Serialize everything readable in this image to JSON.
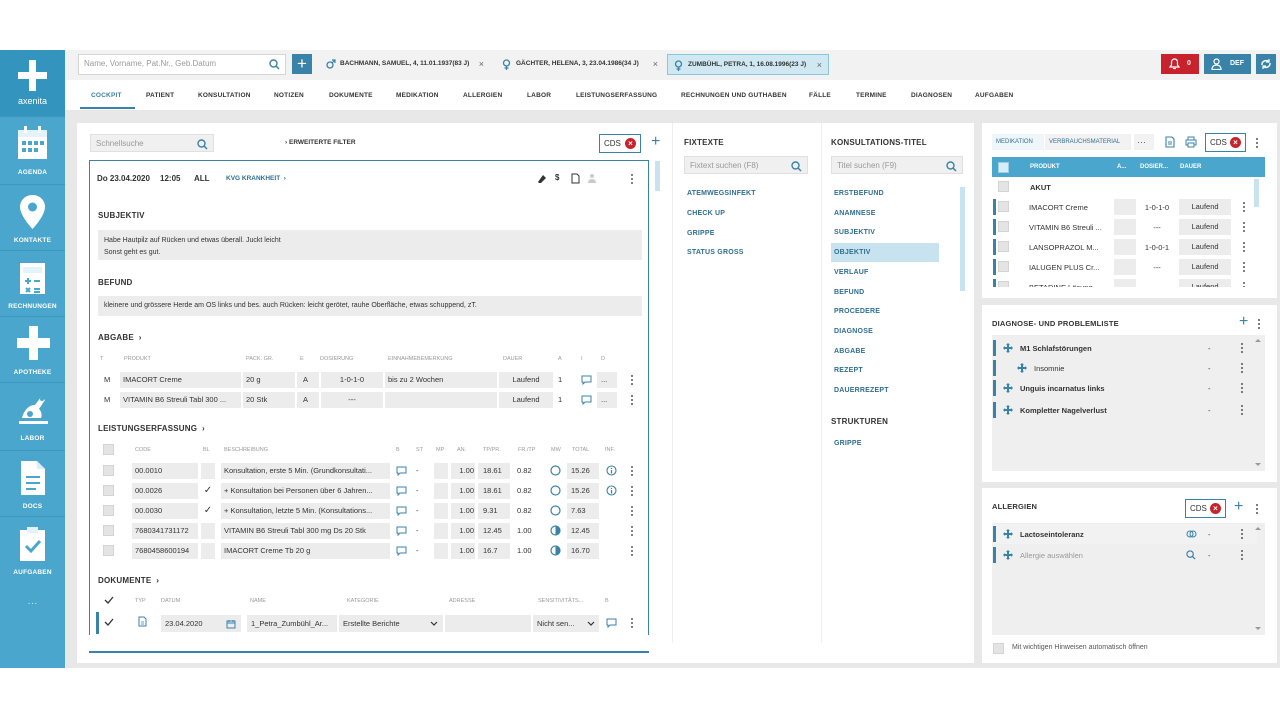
{
  "sidebar": {
    "brand": "axenita",
    "items": [
      {
        "label": "AGENDA",
        "icon": "calendar-icon"
      },
      {
        "label": "KONTAKTE",
        "icon": "location-pin-icon"
      },
      {
        "label": "RECHNUNGEN",
        "icon": "calculator-icon"
      },
      {
        "label": "APOTHEKE",
        "icon": "pharmacy-cross-icon"
      },
      {
        "label": "LABOR",
        "icon": "lab-flask-icon"
      },
      {
        "label": "DOCS",
        "icon": "document-icon"
      },
      {
        "label": "AUFGABEN",
        "icon": "clipboard-check-icon"
      }
    ],
    "more": "···"
  },
  "topbar": {
    "search_placeholder": "Name, Vorname, Pat.Nr., Geb.Datum",
    "add": "+",
    "patients": [
      {
        "label": "BACHMANN, SAMUEL, 4, 11.01.1937(83 J)",
        "icon": "male-icon"
      },
      {
        "label": "GÄCHTER, HELENA, 3, 23.04.1986(34 J)",
        "icon": "female-icon"
      },
      {
        "label": "ZUMBÜHL, PETRA, 1, 16.08.1996(23 J)",
        "icon": "female-icon"
      }
    ],
    "close": "×",
    "notif_count": "0",
    "user": "DEF",
    "colors": {
      "red": "#c8232c",
      "blue": "#3a83a8"
    }
  },
  "tabs": [
    "COCKPIT",
    "PATIENT",
    "KONSULTATION",
    "NOTIZEN",
    "DOKUMENTE",
    "MEDIKATION",
    "ALLERGIEN",
    "LABOR",
    "LEISTUNGSERFASSUNG",
    "RECHNUNGEN UND GUTHABEN",
    "FÄLLE",
    "TERMINE",
    "DIAGNOSEN",
    "AUFGABEN"
  ],
  "consult": {
    "quick_search": "Schnellsuche",
    "ext_filter": "ERWEITERTE FILTER",
    "cds": "CDS",
    "date": "Do 23.04.2020",
    "time": "12:05",
    "scope": "ALL",
    "case": "KVG KRANKHEIT",
    "dollar": "$",
    "subjektiv_title": "SUBJEKTIV",
    "subjektiv_line1": "Habe Hautpilz auf Rücken und etwas überall.  Juckt leicht",
    "subjektiv_line2": "Sonst geht es gut.",
    "befund_title": "BEFUND",
    "befund_text": "kleinere und grössere Herde am OS links und bes. auch Rücken: leicht gerötet, rauhe Oberfläche, etwas schuppend, zT.",
    "abgabe_title": "ABGABE",
    "abgabe_headers": [
      "T",
      "PRODUKT",
      "PACK. GR.",
      "E",
      "DOSIERUNG",
      "EINNAHMEBEMERKUNG",
      "DAUER",
      "A",
      "I",
      "D"
    ],
    "abgabe_rows": [
      [
        "M",
        "IMACORT Creme",
        "20 g",
        "A",
        "1-0-1-0",
        "bis zu 2 Wochen",
        "Laufend",
        "1",
        "",
        "..."
      ],
      [
        "M",
        "VITAMIN B6 Streuli Tabl 300 ...",
        "20 Stk",
        "A",
        "---",
        "",
        "Laufend",
        "1",
        "",
        "..."
      ]
    ],
    "leist_title": "LEISTUNGSERFASSUNG",
    "leist_headers": [
      "CODE",
      "BL",
      "BESCHREIBUNG",
      "B",
      "ST",
      "MP",
      "AN.",
      "TP/PR.",
      "FR./TP",
      "MW",
      "TOTAL",
      "INF."
    ],
    "leist_rows": [
      [
        "00.0010",
        "",
        "Konsultation, erste 5 Min. (Grundkonsultati...",
        "",
        "-",
        "",
        "1.00",
        "18.61",
        "0.82",
        "",
        "15.26",
        ""
      ],
      [
        "00.0026",
        "✓",
        "+ Konsultation bei Personen über 6 Jahren...",
        "",
        "-",
        "",
        "1.00",
        "18.61",
        "0.82",
        "",
        "15.26",
        ""
      ],
      [
        "00.0030",
        "✓",
        "+ Konsultation, letzte 5 Min. (Konsultations...",
        "",
        "-",
        "",
        "1.00",
        "9.31",
        "0.82",
        "",
        "7.63",
        ""
      ],
      [
        "7680341731172",
        "",
        "VITAMIN B6 Streuli Tabl 300 mg Ds 20 Stk",
        "",
        "-",
        "",
        "1.00",
        "12.45",
        "1.00",
        "",
        "12.45",
        ""
      ],
      [
        "7680458600194",
        "",
        "IMACORT Creme Tb 20 g",
        "",
        "-",
        "",
        "1.00",
        "16.7",
        "1.00",
        "",
        "16.70",
        ""
      ]
    ],
    "docs_title": "DOKUMENTE",
    "docs_headers": [
      "TYP",
      "DATUM",
      "NAME",
      "KATEGORIE",
      "ADRESSE",
      "SENSITIVITÄTS...",
      "B"
    ],
    "doc_row": {
      "date": "23.04.2020",
      "name": "1_Petra_Zumbühl_Ar...",
      "category": "Erstellte Berichte",
      "sens": "Nicht sen..."
    }
  },
  "fixtexte": {
    "title": "FIXTEXTE",
    "placeholder": "Fixtext suchen (F8)",
    "items": [
      "ATEMWEGSINFEKT",
      "CHECK UP",
      "GRIPPE",
      "STATUS GROSS"
    ]
  },
  "ktitel": {
    "title": "KONSULTATIONS-TITEL",
    "placeholder": "Titel suchen (F9)",
    "items": [
      "ERSTBEFUND",
      "ANAMNESE",
      "SUBJEKTIV",
      "OBJEKTIV",
      "VERLAUF",
      "BEFUND",
      "PROCEDERE",
      "DIAGNOSE",
      "ABGABE",
      "REZEPT",
      "DAUERREZEPT"
    ],
    "strukturen_title": "STRUKTUREN",
    "strukturen": [
      "GRIPPE"
    ]
  },
  "medikation": {
    "tabs": [
      "MEDIKATION",
      "VERBRAUCHSMATERIAL"
    ],
    "more": "···",
    "cds": "CDS",
    "headers": [
      "PRODUKT",
      "A...",
      "DOSIER...",
      "DAUER"
    ],
    "group": "AKUT",
    "rows": [
      [
        "IMACORT Creme",
        "1-0-1-0",
        "Laufend"
      ],
      [
        "VITAMIN B6 Streuli ...",
        "---",
        "Laufend"
      ],
      [
        "LANSOPRAZOL M...",
        "1-0-0-1",
        "Laufend"
      ],
      [
        "IALUGEN PLUS Cr...",
        "---",
        "Laufend"
      ],
      [
        "BETADINE Lösung",
        "---",
        "Laufend"
      ]
    ]
  },
  "diagnose": {
    "title": "DIAGNOSE- UND PROBLEMLISTE",
    "add": "+",
    "items": [
      {
        "label": "M1 Schlafstörungen",
        "bold": true,
        "value": "-"
      },
      {
        "label": "Insomnie",
        "bold": false,
        "value": "-"
      },
      {
        "label": "Unguis incarnatus links",
        "bold": true,
        "value": "-"
      },
      {
        "label": "Kompletter Nagelverlust",
        "bold": true,
        "value": "-"
      }
    ]
  },
  "allergien": {
    "title": "ALLERGIEN",
    "cds": "CDS",
    "add": "+",
    "items": [
      {
        "label": "Lactoseintoleranz",
        "value": "-"
      },
      {
        "label": "Allergie auswählen",
        "value": "-"
      }
    ],
    "auto_open": "Mit wichtigen Hinweisen automatisch öffnen"
  }
}
